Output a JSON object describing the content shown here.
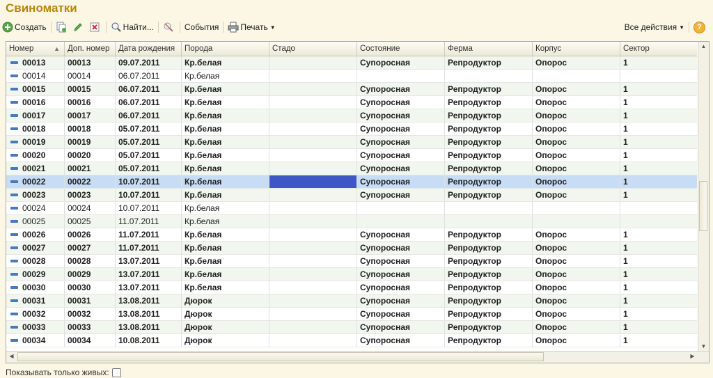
{
  "window": {
    "title": "Свиноматки"
  },
  "toolbar": {
    "create_label": "Создать",
    "find_label": "Найти...",
    "events_label": "События",
    "print_label": "Печать",
    "all_actions_label": "Все действия",
    "help_label": "?"
  },
  "table": {
    "columns": [
      "Номер",
      "Доп. номер",
      "Дата рождения",
      "Порода",
      "Стадо",
      "Состояние",
      "Ферма",
      "Корпус",
      "Сектор"
    ],
    "rows": [
      {
        "num": "00013",
        "extra": "00013",
        "date": "09.07.2011",
        "breed": "Кр.белая",
        "herd": "",
        "state": "Супоросная",
        "farm": "Репродуктор",
        "building": "Опорос",
        "sector": "1",
        "bold": true
      },
      {
        "num": "00014",
        "extra": "00014",
        "date": "06.07.2011",
        "breed": "Кр.белая",
        "herd": "",
        "state": "",
        "farm": "",
        "building": "",
        "sector": "",
        "bold": false
      },
      {
        "num": "00015",
        "extra": "00015",
        "date": "06.07.2011",
        "breed": "Кр.белая",
        "herd": "",
        "state": "Супоросная",
        "farm": "Репродуктор",
        "building": "Опорос",
        "sector": "1",
        "bold": true
      },
      {
        "num": "00016",
        "extra": "00016",
        "date": "06.07.2011",
        "breed": "Кр.белая",
        "herd": "",
        "state": "Супоросная",
        "farm": "Репродуктор",
        "building": "Опорос",
        "sector": "1",
        "bold": true
      },
      {
        "num": "00017",
        "extra": "00017",
        "date": "06.07.2011",
        "breed": "Кр.белая",
        "herd": "",
        "state": "Супоросная",
        "farm": "Репродуктор",
        "building": "Опорос",
        "sector": "1",
        "bold": true
      },
      {
        "num": "00018",
        "extra": "00018",
        "date": "05.07.2011",
        "breed": "Кр.белая",
        "herd": "",
        "state": "Супоросная",
        "farm": "Репродуктор",
        "building": "Опорос",
        "sector": "1",
        "bold": true
      },
      {
        "num": "00019",
        "extra": "00019",
        "date": "05.07.2011",
        "breed": "Кр.белая",
        "herd": "",
        "state": "Супоросная",
        "farm": "Репродуктор",
        "building": "Опорос",
        "sector": "1",
        "bold": true
      },
      {
        "num": "00020",
        "extra": "00020",
        "date": "05.07.2011",
        "breed": "Кр.белая",
        "herd": "",
        "state": "Супоросная",
        "farm": "Репродуктор",
        "building": "Опорос",
        "sector": "1",
        "bold": true
      },
      {
        "num": "00021",
        "extra": "00021",
        "date": "05.07.2011",
        "breed": "Кр.белая",
        "herd": "",
        "state": "Супоросная",
        "farm": "Репродуктор",
        "building": "Опорос",
        "sector": "1",
        "bold": true
      },
      {
        "num": "00022",
        "extra": "00022",
        "date": "10.07.2011",
        "breed": "Кр.белая",
        "herd": "",
        "state": "Супоросная",
        "farm": "Репродуктор",
        "building": "Опорос",
        "sector": "1",
        "bold": true,
        "selected": true
      },
      {
        "num": "00023",
        "extra": "00023",
        "date": "10.07.2011",
        "breed": "Кр.белая",
        "herd": "",
        "state": "Супоросная",
        "farm": "Репродуктор",
        "building": "Опорос",
        "sector": "1",
        "bold": true
      },
      {
        "num": "00024",
        "extra": "00024",
        "date": "10.07.2011",
        "breed": "Кр.белая",
        "herd": "",
        "state": "",
        "farm": "",
        "building": "",
        "sector": "",
        "bold": false
      },
      {
        "num": "00025",
        "extra": "00025",
        "date": "11.07.2011",
        "breed": "Кр.белая",
        "herd": "",
        "state": "",
        "farm": "",
        "building": "",
        "sector": "",
        "bold": false
      },
      {
        "num": "00026",
        "extra": "00026",
        "date": "11.07.2011",
        "breed": "Кр.белая",
        "herd": "",
        "state": "Супоросная",
        "farm": "Репродуктор",
        "building": "Опорос",
        "sector": "1",
        "bold": true
      },
      {
        "num": "00027",
        "extra": "00027",
        "date": "11.07.2011",
        "breed": "Кр.белая",
        "herd": "",
        "state": "Супоросная",
        "farm": "Репродуктор",
        "building": "Опорос",
        "sector": "1",
        "bold": true
      },
      {
        "num": "00028",
        "extra": "00028",
        "date": "13.07.2011",
        "breed": "Кр.белая",
        "herd": "",
        "state": "Супоросная",
        "farm": "Репродуктор",
        "building": "Опорос",
        "sector": "1",
        "bold": true
      },
      {
        "num": "00029",
        "extra": "00029",
        "date": "13.07.2011",
        "breed": "Кр.белая",
        "herd": "",
        "state": "Супоросная",
        "farm": "Репродуктор",
        "building": "Опорос",
        "sector": "1",
        "bold": true
      },
      {
        "num": "00030",
        "extra": "00030",
        "date": "13.07.2011",
        "breed": "Кр.белая",
        "herd": "",
        "state": "Супоросная",
        "farm": "Репродуктор",
        "building": "Опорос",
        "sector": "1",
        "bold": true
      },
      {
        "num": "00031",
        "extra": "00031",
        "date": "13.08.2011",
        "breed": "Дюрок",
        "herd": "",
        "state": "Супоросная",
        "farm": "Репродуктор",
        "building": "Опорос",
        "sector": "1",
        "bold": true
      },
      {
        "num": "00032",
        "extra": "00032",
        "date": "13.08.2011",
        "breed": "Дюрок",
        "herd": "",
        "state": "Супоросная",
        "farm": "Репродуктор",
        "building": "Опорос",
        "sector": "1",
        "bold": true
      },
      {
        "num": "00033",
        "extra": "00033",
        "date": "13.08.2011",
        "breed": "Дюрок",
        "herd": "",
        "state": "Супоросная",
        "farm": "Репродуктор",
        "building": "Опорос",
        "sector": "1",
        "bold": true
      },
      {
        "num": "00034",
        "extra": "00034",
        "date": "10.08.2011",
        "breed": "Дюрок",
        "herd": "",
        "state": "Супоросная",
        "farm": "Репродуктор",
        "building": "Опорос",
        "sector": "1",
        "bold": true
      }
    ]
  },
  "footer": {
    "only_alive_label": "Показывать только живых:"
  }
}
